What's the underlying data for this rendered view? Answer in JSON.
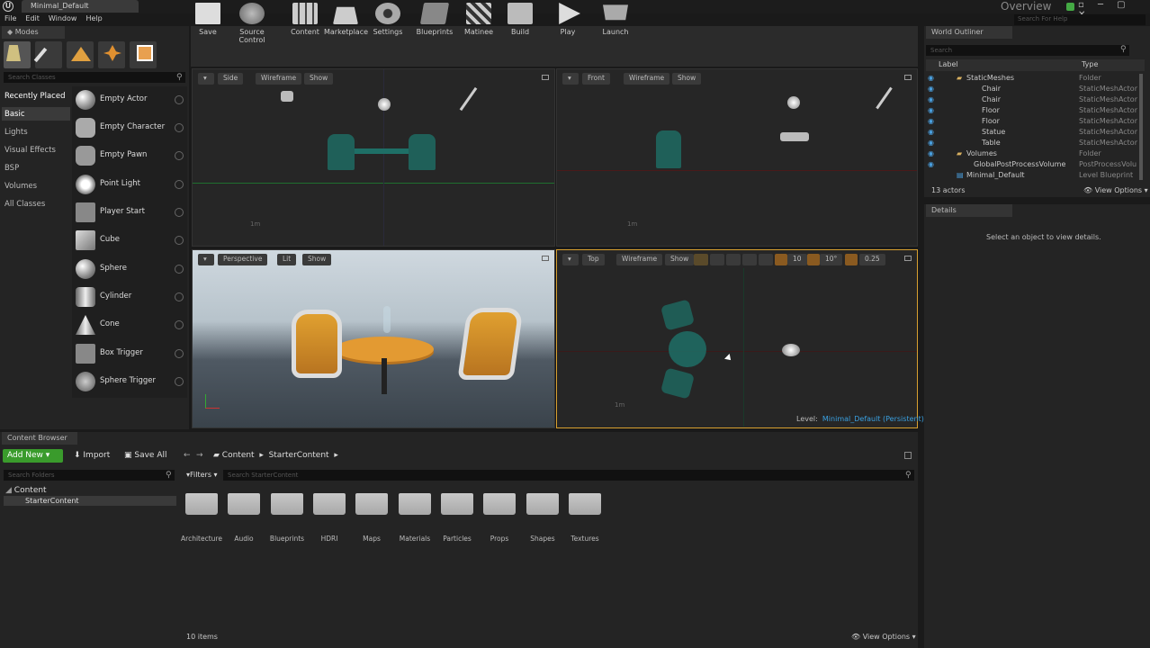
{
  "title_bar": {
    "document_tab": "Minimal_Default",
    "overview": "Overview",
    "help_search": "Search For Help"
  },
  "menu": [
    "File",
    "Edit",
    "Window",
    "Help"
  ],
  "modes": {
    "tab": "Modes",
    "search_placeholder": "Search Classes",
    "categories": [
      "Recently Placed",
      "Basic",
      "Lights",
      "Visual Effects",
      "BSP",
      "Volumes",
      "All Classes"
    ],
    "items": [
      "Empty Actor",
      "Empty Character",
      "Empty Pawn",
      "Point Light",
      "Player Start",
      "Cube",
      "Sphere",
      "Cylinder",
      "Cone",
      "Box Trigger",
      "Sphere Trigger"
    ]
  },
  "toolbar": {
    "tools": [
      "Save",
      "Source Control",
      "Content",
      "Marketplace",
      "Settings",
      "Blueprints",
      "Matinee",
      "Build",
      "Play",
      "Launch"
    ]
  },
  "viewports": {
    "side": {
      "name": "Side",
      "mode": "Wireframe",
      "show": "Show",
      "scale": "1m"
    },
    "front": {
      "name": "Front",
      "mode": "Wireframe",
      "show": "Show",
      "scale": "1m"
    },
    "perspective": {
      "name": "Perspective",
      "mode": "Lit",
      "show": "Show"
    },
    "top": {
      "name": "Top",
      "mode": "Wireframe",
      "show": "Show",
      "grid": "10",
      "rot": "10°",
      "scale_snap": "0.25",
      "scale": "1m",
      "level_label": "Level:",
      "level_name": "Minimal_Default (Persistent)"
    }
  },
  "outliner": {
    "tab": "World Outliner",
    "search_placeholder": "Search",
    "col_label": "Label",
    "col_type": "Type",
    "rows": [
      {
        "label": "StaticMeshes",
        "type": "Folder"
      },
      {
        "label": "Chair",
        "type": "StaticMeshActor"
      },
      {
        "label": "Chair",
        "type": "StaticMeshActor"
      },
      {
        "label": "Floor",
        "type": "StaticMeshActor"
      },
      {
        "label": "Floor",
        "type": "StaticMeshActor"
      },
      {
        "label": "Statue",
        "type": "StaticMeshActor"
      },
      {
        "label": "Table",
        "type": "StaticMeshActor"
      },
      {
        "label": "Volumes",
        "type": "Folder"
      },
      {
        "label": "GlobalPostProcessVolume",
        "type": "PostProcessVolu"
      },
      {
        "label": "Minimal_Default",
        "type": "Level Blueprint"
      }
    ],
    "count": "13 actors",
    "view_options": "View Options"
  },
  "details": {
    "tab": "Details",
    "empty": "Select an object to view details."
  },
  "content_browser": {
    "tab": "Content Browser",
    "add_new": "Add New",
    "import": "Import",
    "save_all": "Save All",
    "path": [
      "Content",
      "StarterContent"
    ],
    "search_folders": "Search Folders",
    "tree_root": "Content",
    "tree_child": "StarterContent",
    "filters": "Filters",
    "search_content": "Search StarterContent",
    "folders": [
      "Architecture",
      "Audio",
      "Blueprints",
      "HDRI",
      "Maps",
      "Materials",
      "Particles",
      "Props",
      "Shapes",
      "Textures"
    ],
    "count": "10 items",
    "view_options": "View Options"
  },
  "colors": {
    "accent_green": "#3a9b2c",
    "wire_teal": "#1e6f66",
    "chair_orange": "#e0a030",
    "level_blue": "#3aa0e0"
  }
}
